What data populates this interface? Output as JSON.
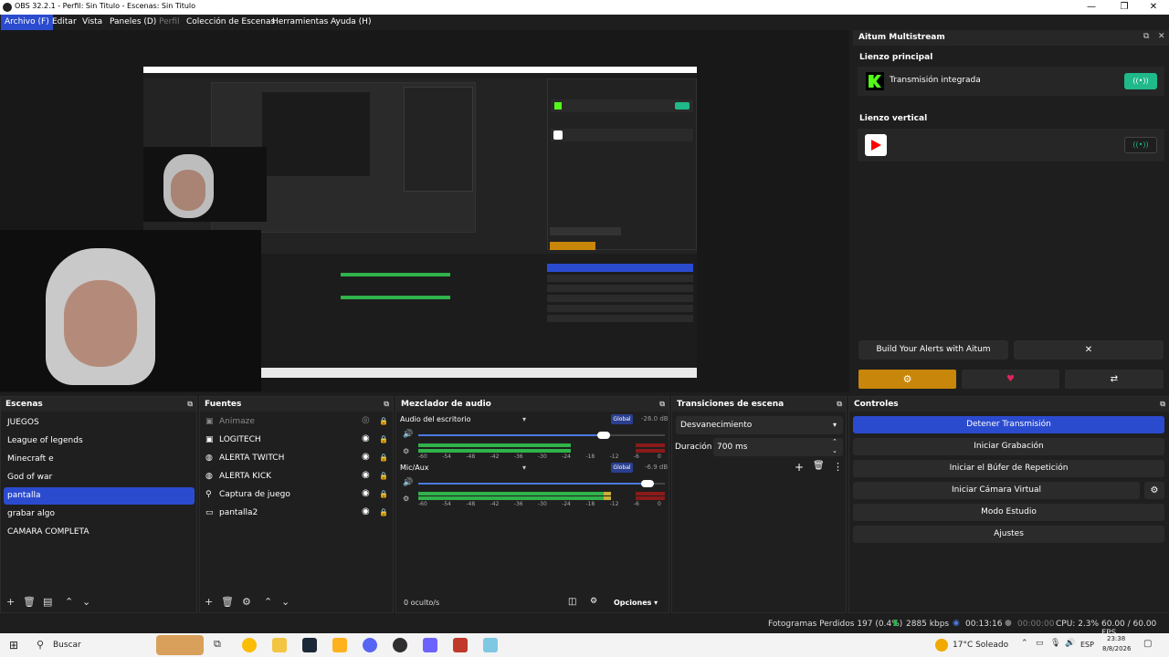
{
  "window": {
    "title": "OBS 32.2.1 - Perfil: Sin Titulo - Escenas: Sin Titulo",
    "controls": [
      "—",
      "❐",
      "✕"
    ]
  },
  "menu": {
    "items": [
      "Archivo (F)",
      "Editar",
      "Vista",
      "Paneles (D)",
      "Perfil",
      "Colección de Escenas",
      "Herramientas",
      "Ayuda (H)"
    ]
  },
  "aitum": {
    "title": "Aitum Multistream",
    "main_canvas_label": "Lienzo principal",
    "main_stream_name": "Transmisión integrada",
    "vertical_canvas_label": "Lienzo vertical",
    "build_alerts_label": "Build Your Alerts with Aitum",
    "close_glyph": "✕",
    "colors": {
      "accent_green": "#1fb98a",
      "orange": "#c8860a",
      "kick_green": "#53fc18",
      "youtube_red": "#ff0000"
    }
  },
  "scenes": {
    "title": "Escenas",
    "items": [
      "JUEGOS",
      "League of legends",
      "Minecraft e",
      "God of war",
      "pantalla",
      "grabar algo",
      "CAMARA COMPLETA"
    ],
    "selected_index": 4
  },
  "sources": {
    "title": "Fuentes",
    "items": [
      {
        "name": "Animaze",
        "icon": "camera-icon",
        "hidden": true
      },
      {
        "name": "LOGITECH",
        "icon": "camera-icon",
        "hidden": false
      },
      {
        "name": "ALERTA TWITCH",
        "icon": "globe-icon",
        "hidden": false
      },
      {
        "name": "ALERTA KICK",
        "icon": "globe-icon",
        "hidden": false
      },
      {
        "name": "Captura de juego",
        "icon": "gamepad-icon",
        "hidden": false
      },
      {
        "name": "pantalla2",
        "icon": "monitor-icon",
        "hidden": false
      }
    ]
  },
  "mixer": {
    "title": "Mezclador de audio",
    "channels": [
      {
        "name": "Audio del escritorio",
        "badge": "Global",
        "db": "-26.0 dB",
        "volume": 0.75,
        "level": 0.62
      },
      {
        "name": "Mic/Aux",
        "badge": "Global",
        "db": "-6.9 dB",
        "volume": 0.93,
        "level": 0.78
      }
    ],
    "scale": [
      "-60",
      "-54",
      "-48",
      "-42",
      "-36",
      "-30",
      "-24",
      "-18",
      "-12",
      "-6",
      "0"
    ],
    "hidden_count": "0 oculto/s",
    "options_label": "Opciones"
  },
  "transitions": {
    "title": "Transiciones de escena",
    "selected": "Desvanecimiento",
    "duration_label": "Duración",
    "duration_value": "700 ms"
  },
  "controls": {
    "title": "Controles",
    "buttons": [
      "Detener Transmisión",
      "Iniciar Grabación",
      "Iniciar el Búfer de Repetición",
      "Iniciar Cámara Virtual",
      "Modo Estudio",
      "Ajustes"
    ]
  },
  "status": {
    "dropped": "Fotogramas Perdidos 197 (0.4%)",
    "bitrate": "2885 kbps",
    "stream_time": "00:13:16",
    "rec_time": "00:00:00",
    "cpu": "CPU: 2.3%",
    "fps": "60.00 / 60.00 FPS"
  },
  "taskbar": {
    "search": "Buscar",
    "weather": "17°C  Soleado",
    "lang": "ESP",
    "time": "23:38",
    "date": "8/8/2026"
  }
}
